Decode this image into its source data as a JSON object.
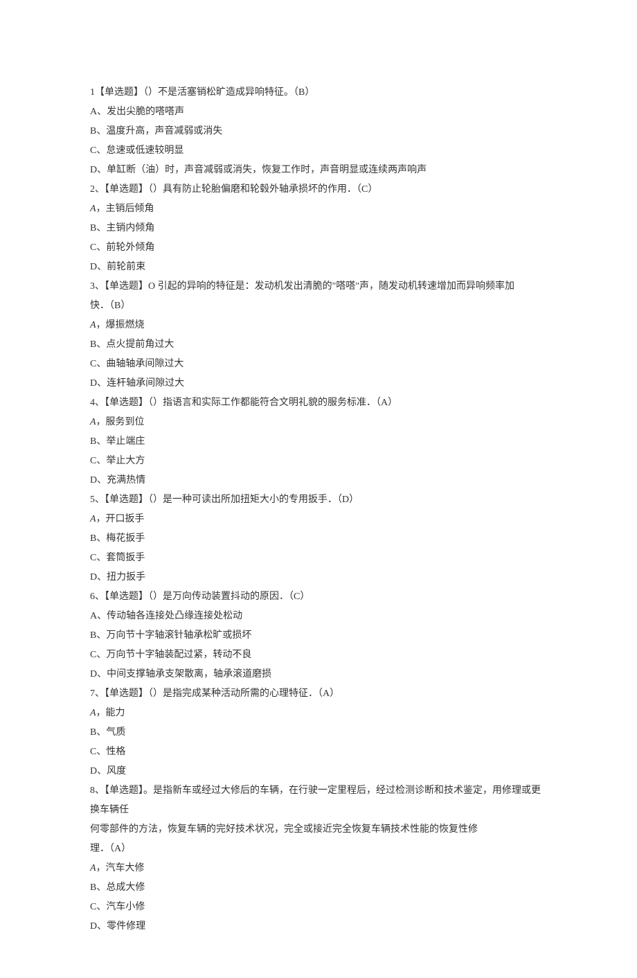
{
  "questions": [
    {
      "stem": "1【单选题】（）不是活塞销松旷造成异响特征。（B）",
      "options": [
        "A、发出尖脆的嗒嗒声",
        "B、温度升高，声音减弱或消失",
        "C、怠速或低速较明显",
        "D、单缸断（油）时，声音减弱或消失，恢复工作时，声音明显或连续两声响声"
      ]
    },
    {
      "stem": "2、【单选题】（）具有防止轮胎偏磨和轮毂外轴承损坏的作用．（C）",
      "options": [
        "A，主销后倾角",
        "B、主销内倾角",
        "C、前轮外倾角",
        "D、前轮前束"
      ]
    },
    {
      "stem": "3、【单选题】O 引起的异响的特征是：发动机发出清脆的\"嗒嗒\"声，随发动机转速增加而异响频率加",
      "stem2": "快．（B）",
      "options": [
        "A，爆振燃烧",
        "B、点火提前角过大",
        "C、曲轴轴承间隙过大",
        "D、连杆轴承间隙过大"
      ]
    },
    {
      "stem": "4、【单选题】（）指语言和实际工作都能符合文明礼貌的服务标准．（A）",
      "options": [
        "A，服务到位",
        "B、举止端庄",
        "C、举止大方",
        "D、充满热情"
      ]
    },
    {
      "stem": "5、【单选题】（）是一种可读出所加扭矩大小的专用扳手．（D）",
      "options": [
        "A，开口扳手",
        "B、梅花扳手",
        "C、套筒扳手",
        "D、扭力扳手"
      ]
    },
    {
      "stem": "6、【单选题】（）是万向传动装置抖动的原因．（C）",
      "options": [
        "A、传动轴各连接处凸缘连接处松动",
        "B、万向节十字轴滚针轴承松旷或损坏",
        "C、万向节十字轴装配过紧，转动不良",
        "D、中间支撑轴承支架散离，轴承滚道磨损"
      ]
    },
    {
      "stem": "7、【单选题】（）是指完成某种活动所需的心理特征．（A）",
      "options": [
        "A，能力",
        "B、气质",
        "C、性格",
        "D、风度"
      ]
    },
    {
      "stem": "8、【单选题】。是指新车或经过大修后的车辆，在行驶一定里程后，经过检测诊断和技术鉴定，用修理或更换车辆任",
      "stem2": "何零部件的方法，恢复车辆的完好技术状况，完全或接近完全恢复车辆技术性能的恢复性修",
      "stem3": "理．（A）",
      "options": [
        "A，汽车大修",
        "B、总成大修",
        "C、汽车小修",
        "D、零件修理"
      ]
    }
  ]
}
